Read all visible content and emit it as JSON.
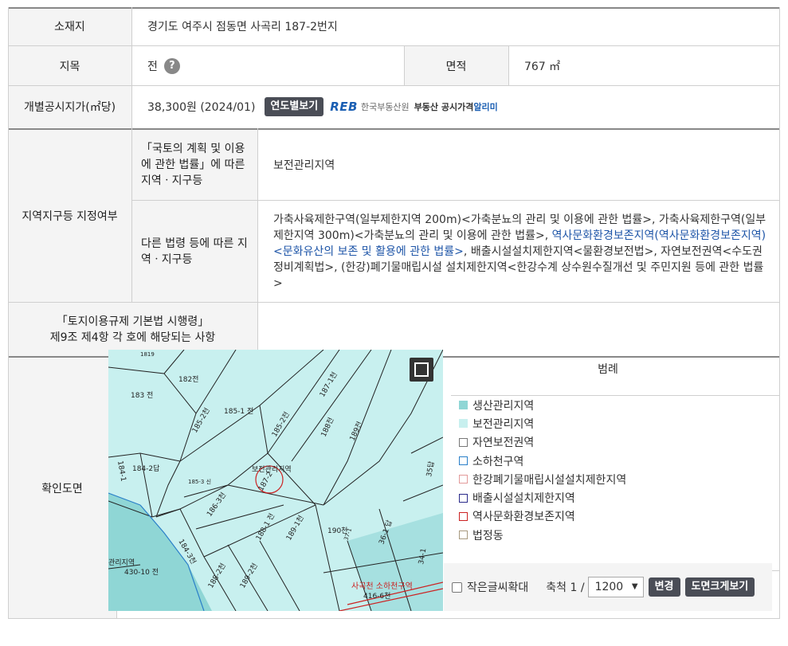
{
  "rows": {
    "location": {
      "label": "소재지",
      "value": "경기도 여주시 점동면 사곡리 187-2번지"
    },
    "land_category": {
      "label": "지목",
      "value": "전",
      "help_icon": "?"
    },
    "area": {
      "label": "면적",
      "value": "767 ㎡"
    },
    "price": {
      "label": "개별공시지가(㎡당)",
      "value": "38,300원 (2024/01)",
      "year_button": "연도별보기",
      "reb_logo": "REB",
      "reb_name": "한국부동산원",
      "reb_tag": "부동산 공시가격",
      "reb_tag2": "알리미"
    },
    "zoning": {
      "label": "지역지구등 지정여부",
      "sub1_label": "「국토의 계획 및 이용에 관한 법률」에 따른 지역ㆍ지구등",
      "sub1_value": "보전관리지역",
      "sub2_label": "다른 법령 등에 따른 지역ㆍ지구등",
      "sub2_value_a": "가축사육제한구역(일부제한지역 200m)<가축분뇨의 관리 및 이용에 관한 법률>, 가축사육제한구역(일부제한지역 300m)<가축분뇨의 관리 및 이용에 관한 법률>, ",
      "sub2_value_link": "역사문화환경보존지역(역사문화환경보존지역)<문화유산의 보존 및 활용에 관한 법률>",
      "sub2_value_b": ", 배출시설설치제한지역<물환경보전법>, 자연보전권역<수도권정비계획법>, (한강)폐기물매립시설 설치제한지역<한강수계 상수원수질개선 및 주민지원 등에 관한 법률>"
    },
    "enforcement": {
      "label_line1": "「토지이용규제 기본법 시행령」",
      "label_line2": "제9조 제4항 각 호에 해당되는 사항",
      "value": ""
    },
    "map": {
      "label": "확인도면"
    }
  },
  "map_labels": {
    "l1": "183 전",
    "l2": "182전",
    "l3": "185-1 전",
    "l4": "185-2천",
    "l5": "185-2전",
    "l6": "187-1천",
    "l7": "188전",
    "l8": "189전",
    "l9": "184-1",
    "l10": "184-2답",
    "l11": "185-3 신",
    "l12": "보전관리지역",
    "l13": "187-2",
    "l14": "186-3천",
    "l15": "188-1 전",
    "l16": "189-1천",
    "l17": "190천",
    "l18": "36-1 답",
    "l19": "34-1",
    "l20": "35답",
    "l21": "184-3천",
    "l22": "관리지역",
    "l23": "430-10 전",
    "l24": "188-2천",
    "l25": "189-2천",
    "l26": "사곡천 소하천구역",
    "l27": "416-6천",
    "l28": "1819",
    "l29": "37-1"
  },
  "legend": {
    "title": "범례",
    "items": [
      {
        "label": "생산관리지역",
        "fill": "#8fd6d5",
        "border": "#8fd6d5"
      },
      {
        "label": "보전관리지역",
        "fill": "#c8f0ef",
        "border": "#c8f0ef"
      },
      {
        "label": "자연보전권역",
        "fill": "#ffffff",
        "border": "#777777"
      },
      {
        "label": "소하천구역",
        "fill": "#ffffff",
        "border": "#2a7fc9"
      },
      {
        "label": "한강폐기물매립시설설치제한지역",
        "fill": "#ffffff",
        "border": "#e39a9a"
      },
      {
        "label": "배출시설설치제한지역",
        "fill": "#ffffff",
        "border": "#2a2a8a"
      },
      {
        "label": "역사문화환경보존지역",
        "fill": "#ffffff",
        "border": "#cc2222"
      },
      {
        "label": "법정동",
        "fill": "#ffffff",
        "border": "#a89a80"
      }
    ]
  },
  "controls": {
    "small_text_label": "작은글씨확대",
    "scale_label": "축척 1 /",
    "scale_value": "1200",
    "change_button": "변경",
    "enlarge_button": "도면크게보기"
  }
}
